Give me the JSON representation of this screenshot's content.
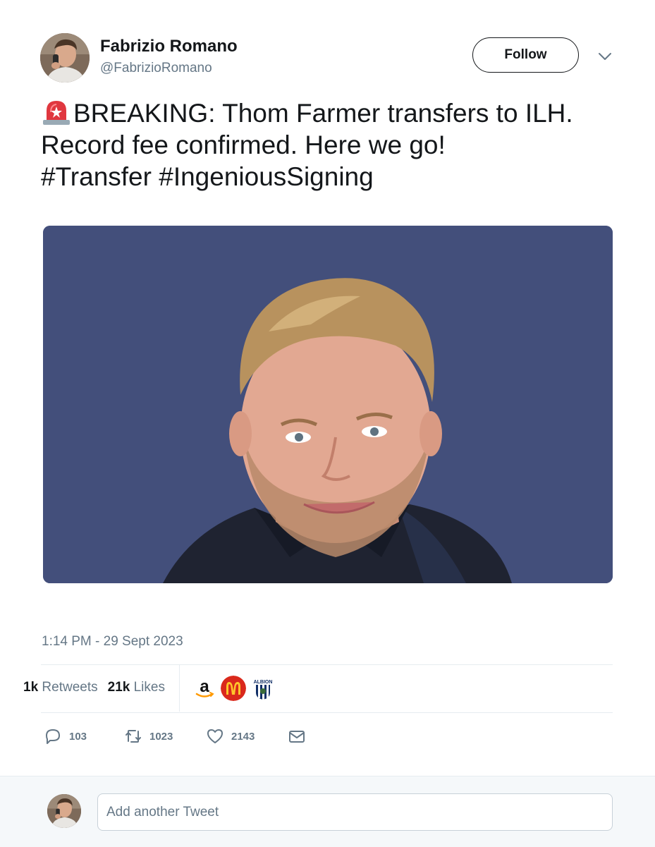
{
  "author": {
    "display_name": "Fabrizio Romano",
    "handle": "@FabrizioRomano",
    "avatar_icon": "profile-photo"
  },
  "header": {
    "follow_label": "Follow",
    "menu_icon": "chevron-down-icon"
  },
  "tweet": {
    "emoji": "police-car-light",
    "lines": [
      "BREAKING: Thom Farmer transfers to ILH.",
      "Record fee confirmed. Here we go!",
      "#Transfer #IngeniousSigning"
    ],
    "media_background": "#434f7b",
    "timestamp": "1:14 PM - 29 Sept 2023"
  },
  "stats": {
    "retweets_count": "1k",
    "retweets_label": "Retweets",
    "likes_count": "21k",
    "likes_label": "Likes",
    "likers": [
      {
        "name": "amazon-logo",
        "glyph": "a"
      },
      {
        "name": "mcdonalds-logo",
        "glyph": "M"
      },
      {
        "name": "albion-crest",
        "glyph": "ALBION"
      }
    ]
  },
  "actions": {
    "replies": "103",
    "retweets": "1023",
    "likes": "2143"
  },
  "reply_box": {
    "placeholder": "Add another Tweet"
  },
  "colors": {
    "text": "#14171a",
    "muted": "#657786",
    "border": "#e6ecf0",
    "siren_red": "#e0373f"
  }
}
